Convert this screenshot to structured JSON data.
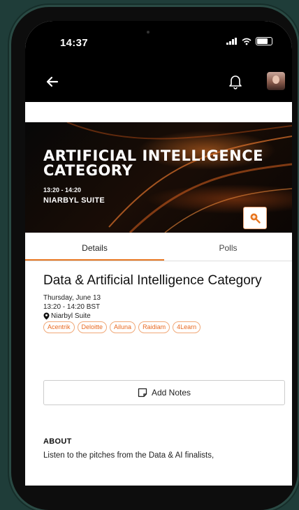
{
  "status_bar": {
    "time": "14:37"
  },
  "header": {
    "back_icon": "arrow-left-icon",
    "notification_icon": "bell-icon",
    "avatar": "user-avatar"
  },
  "banner": {
    "title_line1": "ARTIFICIAL INTELLIGENCE",
    "title_line2": "CATEGORY",
    "time": "13:20 - 14:20",
    "room": "NIARBYL SUITE",
    "zoom_icon": "zoom-in-icon"
  },
  "tabs": [
    {
      "label": "Details",
      "active": true
    },
    {
      "label": "Polls",
      "active": false
    }
  ],
  "session": {
    "title": "Data & Artificial Intelligence Category",
    "date": "Thursday, June 13",
    "time": "13:20 - 14:20 BST",
    "room": "Niarbyl Suite",
    "tags": [
      "Acentrik",
      "Deloitte",
      "Ailuna",
      "Raidiam",
      "4Learn"
    ]
  },
  "notes_button": {
    "label": "Add Notes",
    "icon": "note-icon"
  },
  "about": {
    "heading": "ABOUT",
    "text": "Listen to the pitches from the Data & AI finalists,"
  },
  "colors": {
    "accent": "#e87722",
    "background": "#1f3d39"
  }
}
